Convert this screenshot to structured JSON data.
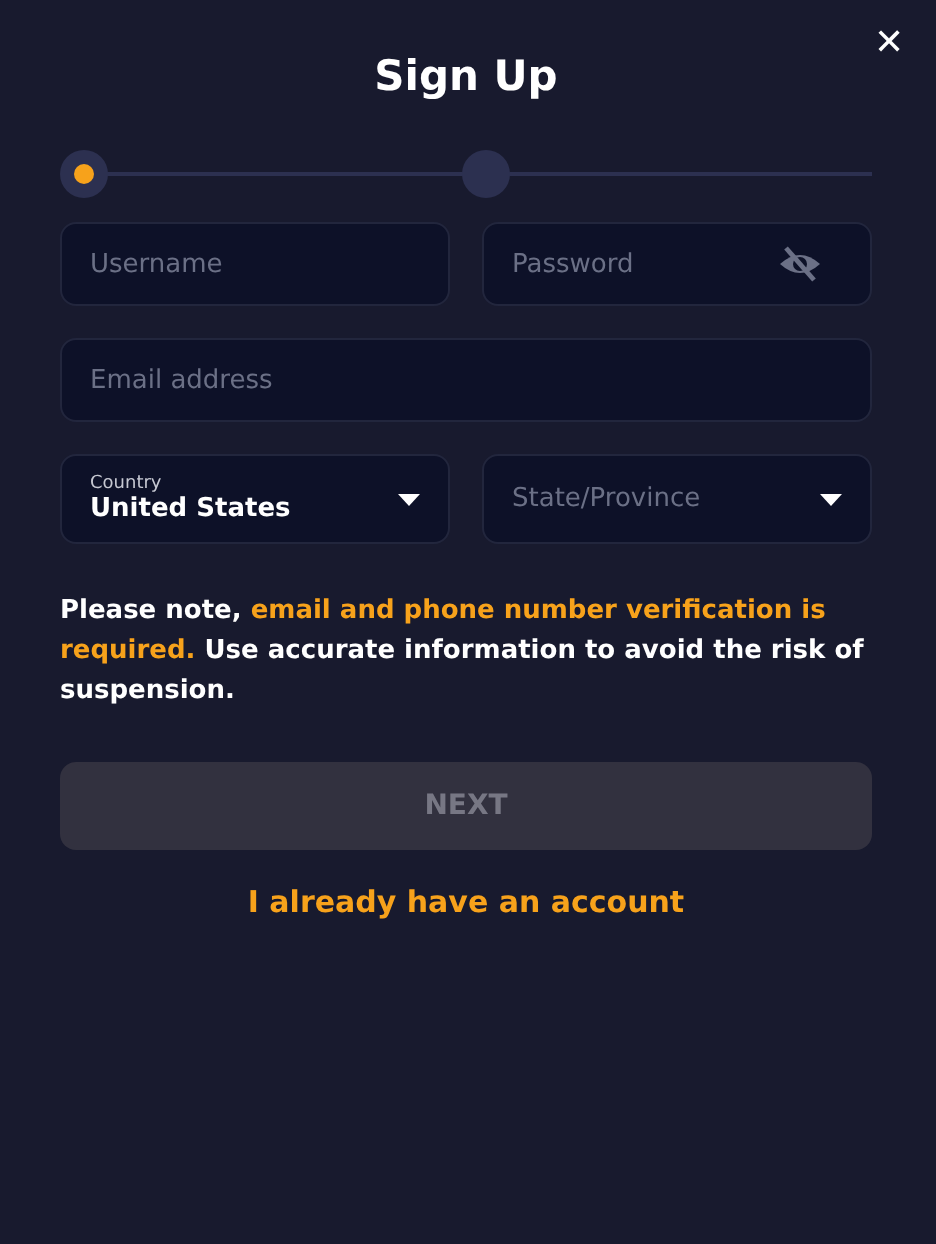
{
  "title": "Sign Up",
  "close": "✕",
  "steps": [
    {
      "selected": true
    },
    {
      "selected": false
    }
  ],
  "fields": [
    {
      "kind": "text",
      "placeholder": "Username"
    },
    {
      "kind": "password",
      "placeholder": "Password",
      "hidden": true
    },
    {
      "kind": "text",
      "placeholder": "Email address",
      "wide": true
    },
    {
      "kind": "select",
      "label": "Country",
      "value": "United States"
    },
    {
      "kind": "select",
      "placeholder": "State/Province"
    }
  ],
  "note": [
    {
      "text": "Please note, ",
      "highlight": false
    },
    {
      "text": "email and phone number verification is required.",
      "highlight": true
    },
    {
      "text": " Use accurate information to avoid the risk of suspension.",
      "highlight": false
    }
  ],
  "next_button": {
    "label": "NEXT",
    "disabled": true
  },
  "login_link": "I already have an account"
}
